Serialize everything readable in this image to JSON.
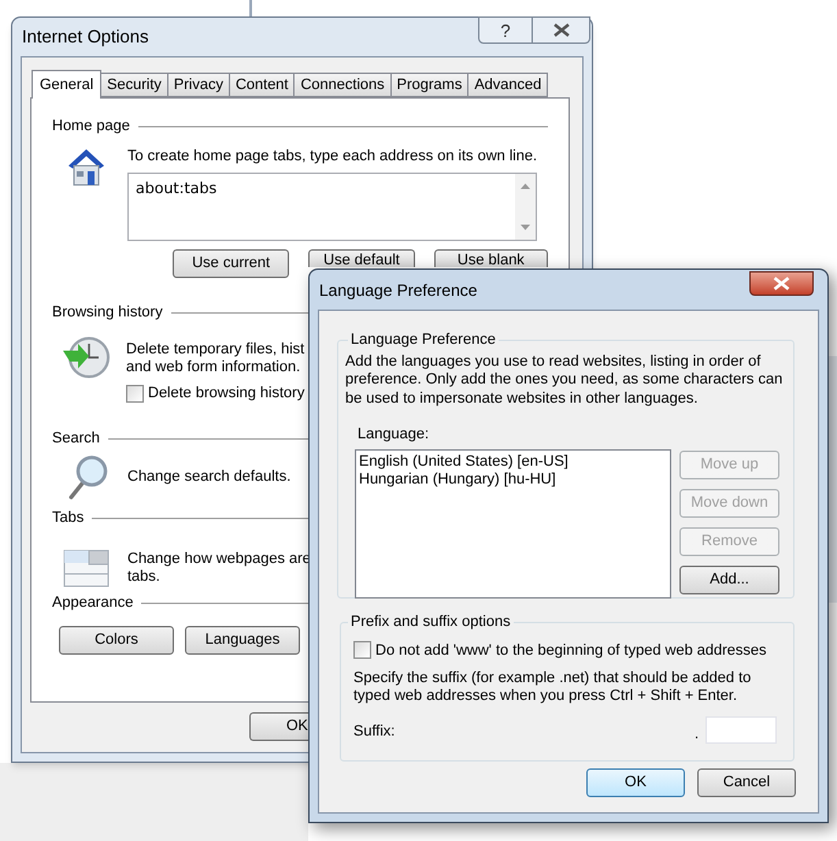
{
  "internet_options": {
    "title": "Internet Options",
    "help": "?",
    "tabs": [
      {
        "label": "General",
        "selected": true
      },
      {
        "label": "Security",
        "selected": false
      },
      {
        "label": "Privacy",
        "selected": false
      },
      {
        "label": "Content",
        "selected": false
      },
      {
        "label": "Connections",
        "selected": false
      },
      {
        "label": "Programs",
        "selected": false
      },
      {
        "label": "Advanced",
        "selected": false
      }
    ],
    "home_page": {
      "heading": "Home page",
      "instruction": "To create home page tabs, type each address on its own line.",
      "addresses": "about:tabs",
      "buttons": [
        "Use current",
        "Use default",
        "Use blank"
      ]
    },
    "browsing_history": {
      "heading": "Browsing history",
      "description": [
        "Delete temporary files, hist",
        "and web form information."
      ],
      "delete_on_exit": {
        "label": "Delete browsing history",
        "checked": false
      }
    },
    "search": {
      "heading": "Search",
      "description": "Change search defaults."
    },
    "tabs_section": {
      "heading": "Tabs",
      "description": [
        "Change how webpages are",
        "tabs."
      ]
    },
    "appearance": {
      "heading": "Appearance",
      "buttons": [
        "Colors",
        "Languages"
      ]
    },
    "ok": "OK"
  },
  "language_preference": {
    "title": "Language Preference",
    "group_title": "Language Preference",
    "description": "Add the languages you use to read websites, listing in order of preference. Only add the ones you need, as some characters can be used to impersonate websites in other languages.",
    "list_label": "Language:",
    "languages": [
      {
        "label": "English (United States) [en-US]",
        "selected": false
      },
      {
        "label": "Hungarian (Hungary) [hu-HU]",
        "selected": false
      }
    ],
    "buttons": [
      {
        "label": "Move up",
        "disabled": true
      },
      {
        "label": "Move down",
        "disabled": true
      },
      {
        "label": "Remove",
        "disabled": true
      },
      {
        "label": "Add...",
        "disabled": false
      }
    ],
    "prefix_group_title": "Prefix and suffix options",
    "no_www": {
      "label": "Do not add 'www' to the beginning of typed web addresses",
      "checked": false
    },
    "suffix_hint": "Specify the suffix (for example .net) that should be added to typed web addresses when you press Ctrl + Shift + Enter.",
    "suffix_label": "Suffix:",
    "suffix_dot": ".",
    "ok": "OK",
    "cancel": "Cancel"
  }
}
